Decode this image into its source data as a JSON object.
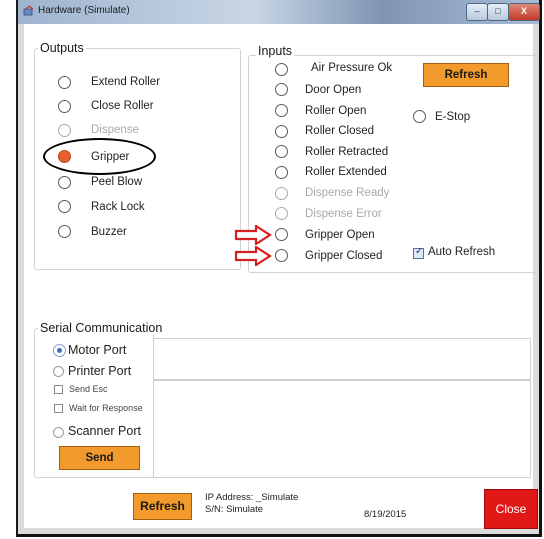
{
  "window": {
    "title": "Hardware (Simulate)",
    "controls": {
      "minimize": "–",
      "maximize": "□",
      "close": "X"
    }
  },
  "outputs": {
    "legend": "Outputs",
    "items": [
      {
        "label": "Extend Roller",
        "checked": false,
        "enabled": true
      },
      {
        "label": "Close Roller",
        "checked": false,
        "enabled": true
      },
      {
        "label": "Dispense",
        "checked": false,
        "enabled": false
      },
      {
        "label": "Gripper",
        "checked": true,
        "enabled": true
      },
      {
        "label": "Peel Blow",
        "checked": false,
        "enabled": true
      },
      {
        "label": "Rack Lock",
        "checked": false,
        "enabled": true
      },
      {
        "label": "Buzzer",
        "checked": false,
        "enabled": true
      }
    ]
  },
  "inputs": {
    "legend": "Inputs",
    "items": [
      {
        "label": "Air Pressure Ok",
        "enabled": true
      },
      {
        "label": "Door Open",
        "enabled": true
      },
      {
        "label": "Roller Open",
        "enabled": true
      },
      {
        "label": "Roller Closed",
        "enabled": true
      },
      {
        "label": "Roller Retracted",
        "enabled": true
      },
      {
        "label": "Roller Extended",
        "enabled": true
      },
      {
        "label": "Dispense Ready",
        "enabled": false
      },
      {
        "label": "Dispense Error",
        "enabled": false
      },
      {
        "label": "Gripper Open",
        "enabled": true
      },
      {
        "label": "Gripper Closed",
        "enabled": true
      }
    ],
    "estop_label": "E-Stop",
    "refresh_label": "Refresh",
    "auto_refresh_label": "Auto Refresh",
    "auto_refresh_checked": true
  },
  "serial": {
    "legend": "Serial Communication",
    "motor_port": "Motor Port",
    "printer_port": "Printer Port",
    "send_esc": "Send Esc",
    "wait_for_response": "Wait for Response",
    "scanner_port": "Scanner Port",
    "send_label": "Send"
  },
  "footer": {
    "refresh_label": "Refresh",
    "ip_address": "IP Address: _Simulate",
    "serial_number": "S/N: Simulate",
    "date": "8/19/2015",
    "close_label": "Close"
  },
  "colors": {
    "button_orange": "#f39a2c",
    "close_red": "#e01818",
    "checked_radio": "#e8602c",
    "annotation_arrow": "#d42020"
  }
}
